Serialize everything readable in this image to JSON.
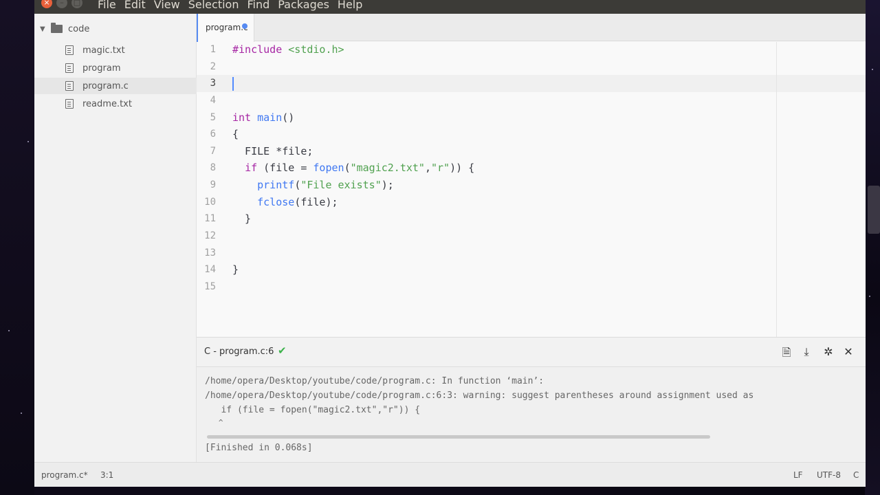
{
  "menubar": {
    "items": [
      "File",
      "Edit",
      "View",
      "Selection",
      "Find",
      "Packages",
      "Help"
    ]
  },
  "tree": {
    "root": "code",
    "files": [
      {
        "name": "magic.txt",
        "selected": false
      },
      {
        "name": "program",
        "selected": false
      },
      {
        "name": "program.c",
        "selected": true
      },
      {
        "name": "readme.txt",
        "selected": false
      }
    ]
  },
  "tab": {
    "title": "program.c",
    "modified": true
  },
  "editor": {
    "active_line": 3,
    "line_numbers": [
      "1",
      "2",
      "3",
      "4",
      "5",
      "6",
      "7",
      "8",
      "9",
      "10",
      "11",
      "12",
      "13",
      "14",
      "15"
    ]
  },
  "panel": {
    "title": "C - program.c:6",
    "status_icon": "check-icon",
    "buttons": [
      "file-icon",
      "download-icon",
      "settings-icon",
      "close-icon"
    ]
  },
  "output": {
    "lines": [
      "/home/opera/Desktop/youtube/code/program.c: In function ‘main’:",
      "/home/opera/Desktop/youtube/code/program.c:6:3: warning: suggest parentheses around assignment used as",
      "   if (file = fopen(\"magic2.txt\",\"r\")) {",
      "   ^",
      "[Finished in 0.068s]"
    ]
  },
  "status": {
    "file": "program.c*",
    "cursor": "3:1",
    "line_ending": "LF",
    "encoding": "UTF-8",
    "grammar": "C"
  },
  "colors": {
    "accent": "#568af2",
    "success": "#3bb24a",
    "menubar": "#3c3b37",
    "close_button": "#e9603b"
  }
}
